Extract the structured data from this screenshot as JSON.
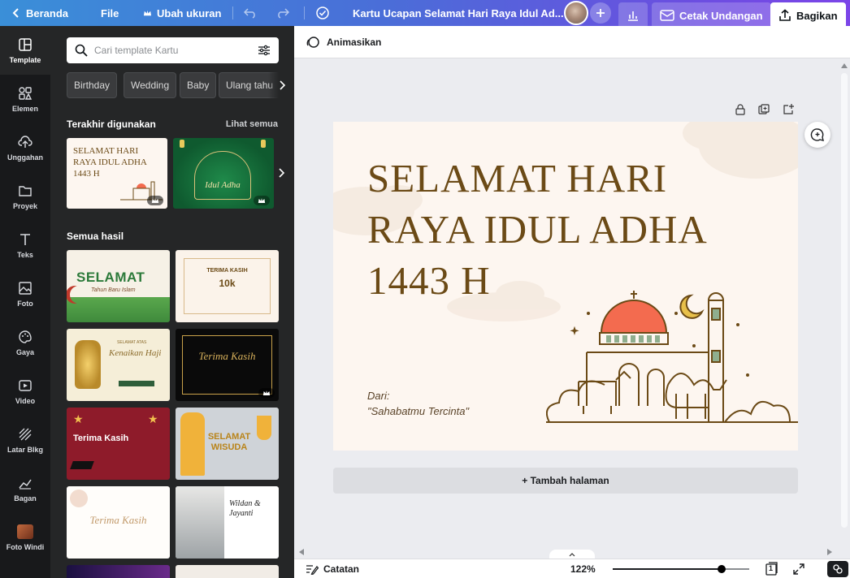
{
  "topbar": {
    "back_label": "Beranda",
    "file_label": "File",
    "resize_label": "Ubah ukuran",
    "doc_title": "Kartu Ucapan Selamat Hari Raya Idul Ad...",
    "print_label": "Cetak Undangan",
    "share_label": "Bagikan"
  },
  "rail": {
    "items": [
      {
        "label": "Template",
        "icon": "template-icon"
      },
      {
        "label": "Elemen",
        "icon": "elements-icon"
      },
      {
        "label": "Unggahan",
        "icon": "upload-icon"
      },
      {
        "label": "Proyek",
        "icon": "folder-icon"
      },
      {
        "label": "Teks",
        "icon": "text-icon"
      },
      {
        "label": "Foto",
        "icon": "photo-icon"
      },
      {
        "label": "Gaya",
        "icon": "palette-icon"
      },
      {
        "label": "Video",
        "icon": "video-icon"
      },
      {
        "label": "Latar Blkg",
        "icon": "background-icon"
      },
      {
        "label": "Bagan",
        "icon": "chart-icon"
      },
      {
        "label": "Foto Windi",
        "icon": "app-icon"
      }
    ]
  },
  "panel": {
    "search_placeholder": "Cari template Kartu",
    "chips": [
      "Birthday",
      "Wedding",
      "Baby",
      "Ulang tahu"
    ],
    "recent_title": "Terakhir digunakan",
    "see_all": "Lihat semua",
    "all_results_title": "Semua hasil",
    "recent": [
      {
        "text": "SELAMAT HARI RAYA IDUL ADHA 1443 H"
      },
      {
        "text": "Idul Adha"
      }
    ],
    "results": [
      {
        "title": "SELAMAT",
        "subtitle": "Tahun Baru Islam"
      },
      {
        "title": "TERIMA KASIH",
        "subtitle": "10k"
      },
      {
        "title": "Kenaikan Haji",
        "subtitle": "SELAMAT ATAS"
      },
      {
        "title": "Terima Kasih",
        "subtitle": ""
      },
      {
        "title": "Terima Kasih",
        "subtitle": ""
      },
      {
        "title": "SELAMAT WISUDA",
        "subtitle": ""
      },
      {
        "title": "Terima Kasih",
        "subtitle": ""
      },
      {
        "title": "Wildan & Jayanti",
        "subtitle": ""
      }
    ]
  },
  "editor": {
    "animate_label": "Animasikan",
    "card": {
      "line1": "SELAMAT HARI",
      "line2": "RAYA IDUL ADHA",
      "line3": "1443 H",
      "from_label": "Dari:",
      "from_name": "\"Sahabatmu Tercinta\""
    },
    "add_page_label": "+ Tambah halaman"
  },
  "bottombar": {
    "notes_label": "Catatan",
    "zoom": "122%",
    "zoom_fraction": 0.8,
    "page_count": "1"
  },
  "colors": {
    "card_text": "#6b4a16",
    "mosque_dome": "#f36b4f",
    "rail_bg": "#18191b",
    "panel_bg": "#252627"
  }
}
